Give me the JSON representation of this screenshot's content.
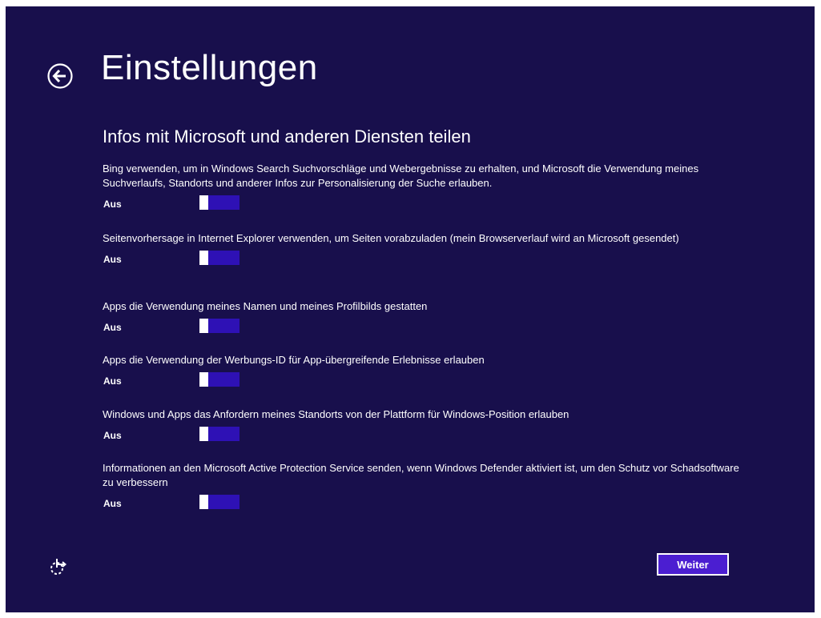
{
  "header": {
    "title": "Einstellungen",
    "back_icon": "back-arrow-icon"
  },
  "section": {
    "title": "Infos mit Microsoft und anderen Diensten teilen"
  },
  "settings": [
    {
      "description": "Bing verwenden, um in Windows Search Suchvorschläge und Webergebnisse zu erhalten, und Microsoft die Verwendung meines Suchverlaufs, Standorts und anderer Infos zur Personalisierung der Suche erlauben.",
      "state": "Aus",
      "on": false
    },
    {
      "description": "Seitenvorhersage in Internet Explorer verwenden, um Seiten vorabzuladen (mein Browserverlauf wird an Microsoft gesendet)",
      "state": "Aus",
      "on": false
    },
    {
      "description": "Apps die Verwendung meines Namen und meines Profilbilds gestatten",
      "state": "Aus",
      "on": false
    },
    {
      "description": "Apps die Verwendung der Werbungs-ID für App-übergreifende Erlebnisse erlauben",
      "state": "Aus",
      "on": false
    },
    {
      "description": "Windows und Apps das Anfordern meines Standorts von der Plattform für Windows-Position erlauben",
      "state": "Aus",
      "on": false
    },
    {
      "description": "Informationen an den Microsoft Active Protection Service senden, wenn Windows Defender aktiviert ist, um den Schutz vor Schadsoftware zu verbessern",
      "state": "Aus",
      "on": false
    }
  ],
  "footer": {
    "ease_of_access_icon": "ease-of-access-icon",
    "next_label": "Weiter"
  },
  "colors": {
    "background": "#180f4c",
    "toggle_track": "#2e11b5",
    "button_fill": "#4b1ed1",
    "text": "#ffffff"
  }
}
